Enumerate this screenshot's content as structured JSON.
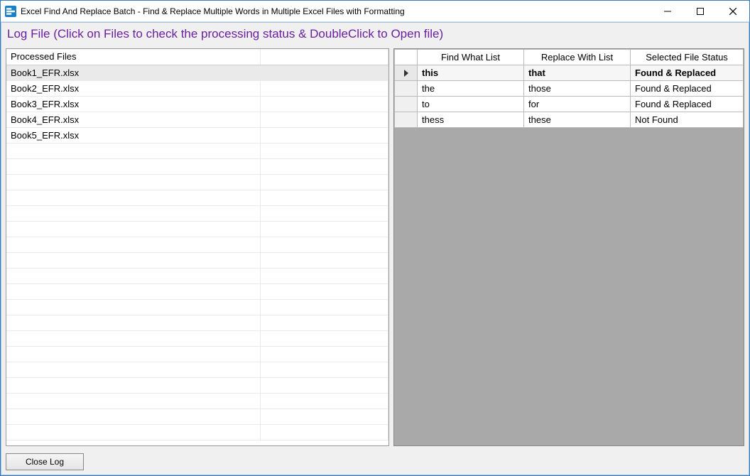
{
  "window": {
    "title": "Excel Find And Replace Batch - Find & Replace Multiple Words in Multiple Excel Files with Formatting"
  },
  "header": {
    "text": "Log File (Click on Files to check the processing status & DoubleClick to Open file)"
  },
  "left": {
    "column_header": "Processed Files",
    "files": [
      "Book1_EFR.xlsx",
      "Book2_EFR.xlsx",
      "Book3_EFR.xlsx",
      "Book4_EFR.xlsx",
      "Book5_EFR.xlsx"
    ],
    "selected_index": 0,
    "blank_rows": 19
  },
  "right": {
    "columns": [
      "Find What List",
      "Replace With List",
      "Selected File Status"
    ],
    "rows": [
      {
        "find": "this",
        "replace": "that",
        "status": "Found & Replaced"
      },
      {
        "find": "the",
        "replace": "those",
        "status": "Found & Replaced"
      },
      {
        "find": "to",
        "replace": "for",
        "status": "Found & Replaced"
      },
      {
        "find": "thess",
        "replace": "these",
        "status": "Not Found"
      }
    ],
    "selected_index": 0
  },
  "footer": {
    "close_log": "Close Log"
  }
}
